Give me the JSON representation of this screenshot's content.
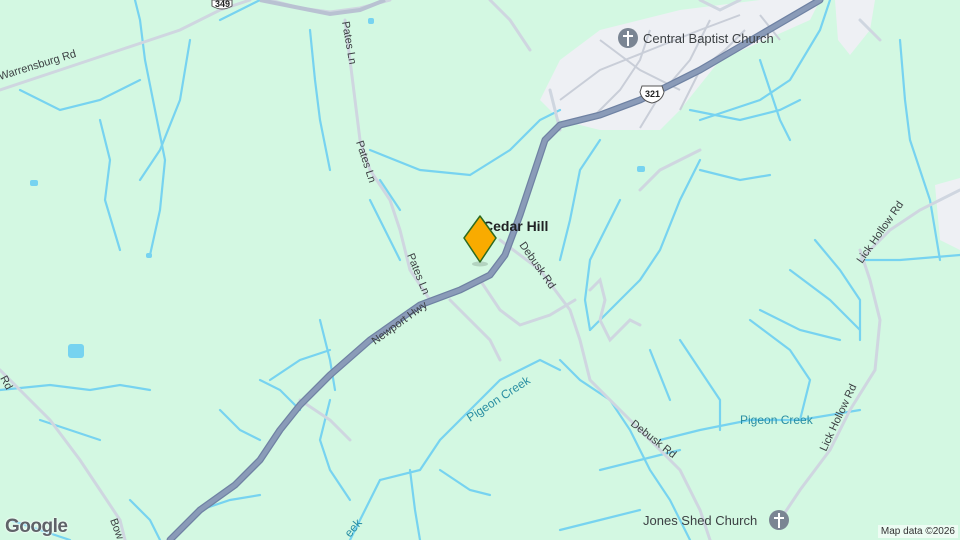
{
  "map": {
    "colors": {
      "land": "#d3f8e2",
      "water": "#77d3f0",
      "major_road": "#8a9bb8",
      "minor_road": "#cfd6e0",
      "town": "#eef0f4",
      "marker": "#f9ab00"
    },
    "place_name": "Cedar Hill",
    "roads": {
      "warrensburg": "Warrensburg Rd",
      "pates_1": "Pates Ln",
      "pates_2": "Pates Ln",
      "pates_3": "Pates Ln",
      "newport": "Newport Hwy",
      "debusk_1": "Debusk Rd",
      "debusk_2": "Debusk Rd",
      "lick_hollow_1": "Lick Hollow Rd",
      "lick_hollow_2": "Lick Hollow Rd",
      "left_rd": "Rd",
      "bow": "Bow"
    },
    "shields": {
      "route_349": "349",
      "route_321": "321"
    },
    "creeks": {
      "pigeon_1": "Pigeon Creek",
      "pigeon_2": "Pigeon Creek",
      "bottom_fragment": "eek"
    },
    "pois": {
      "central_baptist": "Central Baptist Church",
      "jones_shed": "Jones Shed Church"
    },
    "icons": {
      "church": "church-icon",
      "marker": "location-pin-icon"
    },
    "google_logo": "Google",
    "attribution": "Map data ©2026"
  }
}
